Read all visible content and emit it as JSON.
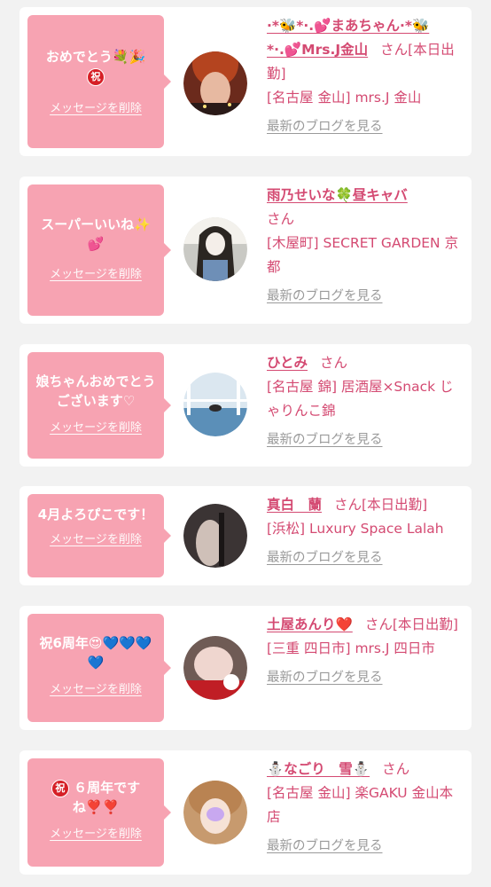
{
  "delete_label": "メッセージを削除",
  "blog_link_label": "最新のブログを見る",
  "san": "さん",
  "colors": {
    "bubble": "#f7a3b2",
    "name": "#d44a72",
    "link": "#9a9a9a",
    "card": "#ffffff",
    "page": "#f2f2f2"
  },
  "items": [
    {
      "message": "おめでとう",
      "message_badge": "祝",
      "name_part1": "Mrs.J金山",
      "name_line": "·*🐝*·.💕まあちゃん·*🐝",
      "name_line2": "*·.💕Mrs.J金山",
      "status": "[本日出勤]",
      "shop": "[名古屋 金山] mrs.J 金山"
    },
    {
      "message": "スーパーいいね✨💕",
      "name": "雨乃せいな🍀昼キャバ",
      "shop": "[木屋町] SECRET GARDEN 京都"
    },
    {
      "message": "娘ちゃんおめでとうございます♡",
      "name": "ひとみ",
      "shop": "[名古屋 錦] 居酒屋×Snack じゃりんこ錦"
    },
    {
      "message": "4月よろぴこです！",
      "name": "真白　蘭",
      "status": "[本日出勤]",
      "shop": "[浜松] Luxury Space Lalah"
    },
    {
      "message": "祝6周年😍💙💙💙💙",
      "name": "土屋あんり❤️",
      "status": "[本日出勤]",
      "shop": "[三重 四日市] mrs.J 四日市"
    },
    {
      "message": "６周年ですね❣️❣️",
      "message_badge": "祝",
      "name": "⛄なごり　雪⛄",
      "shop": "[名古屋 金山] 楽GAKU 金山本店"
    }
  ]
}
